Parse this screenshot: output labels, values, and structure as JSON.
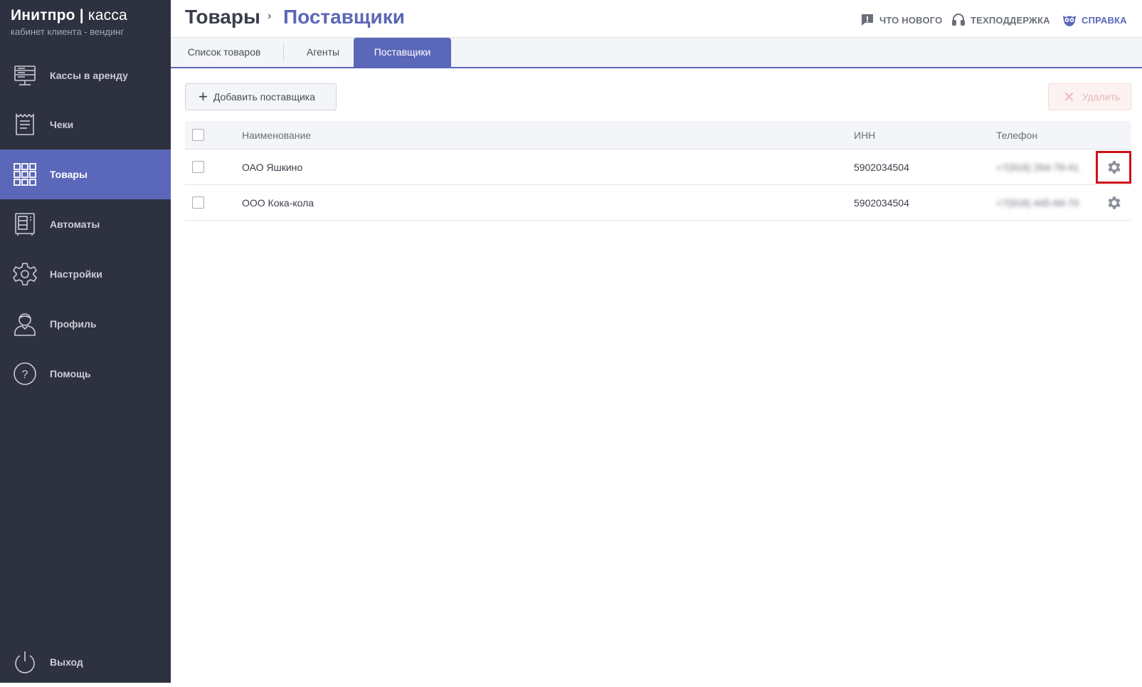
{
  "brand": {
    "name_bold": "Инитпро",
    "name_light": "касса",
    "subtitle": "кабинет клиента - вендинг"
  },
  "sidebar": {
    "items": [
      {
        "label": "Кассы в аренду",
        "icon": "server-icon"
      },
      {
        "label": "Чеки",
        "icon": "receipt-icon"
      },
      {
        "label": "Товары",
        "icon": "grid-icon",
        "active": true
      },
      {
        "label": "Автоматы",
        "icon": "vending-machine-icon"
      },
      {
        "label": "Настройки",
        "icon": "gear-icon"
      },
      {
        "label": "Профиль",
        "icon": "user-icon"
      },
      {
        "label": "Помощь",
        "icon": "help-icon"
      }
    ],
    "logout": {
      "label": "Выход",
      "icon": "power-icon"
    }
  },
  "header": {
    "breadcrumb_root": "Товары",
    "breadcrumb_sep": "›",
    "breadcrumb_current": "Поставщики",
    "links": [
      {
        "label": "ЧТО НОВОГО",
        "icon": "news-icon"
      },
      {
        "label": "ТЕХПОДДЕРЖКА",
        "icon": "headset-icon"
      },
      {
        "label": "СПРАВКА",
        "icon": "owl-icon"
      }
    ]
  },
  "tabs": [
    {
      "label": "Список товаров"
    },
    {
      "label": "Агенты"
    },
    {
      "label": "Поставщики",
      "active": true
    }
  ],
  "toolbar": {
    "add_label": "Добавить поставщика",
    "delete_label": "Удалить"
  },
  "table": {
    "columns": {
      "name": "Наименование",
      "inn": "ИНН",
      "phone": "Телефон"
    },
    "rows": [
      {
        "name": "ОАО Яшкино",
        "inn": "5902034504",
        "phone": "+7(918) 264-78-41"
      },
      {
        "name": "ООО Кока-кола",
        "inn": "5902034504",
        "phone": "+7(918) 445-66-70"
      }
    ]
  },
  "colors": {
    "sidebar_bg": "#2e3240",
    "accent": "#5b67b8",
    "highlight": "#d0101b"
  }
}
